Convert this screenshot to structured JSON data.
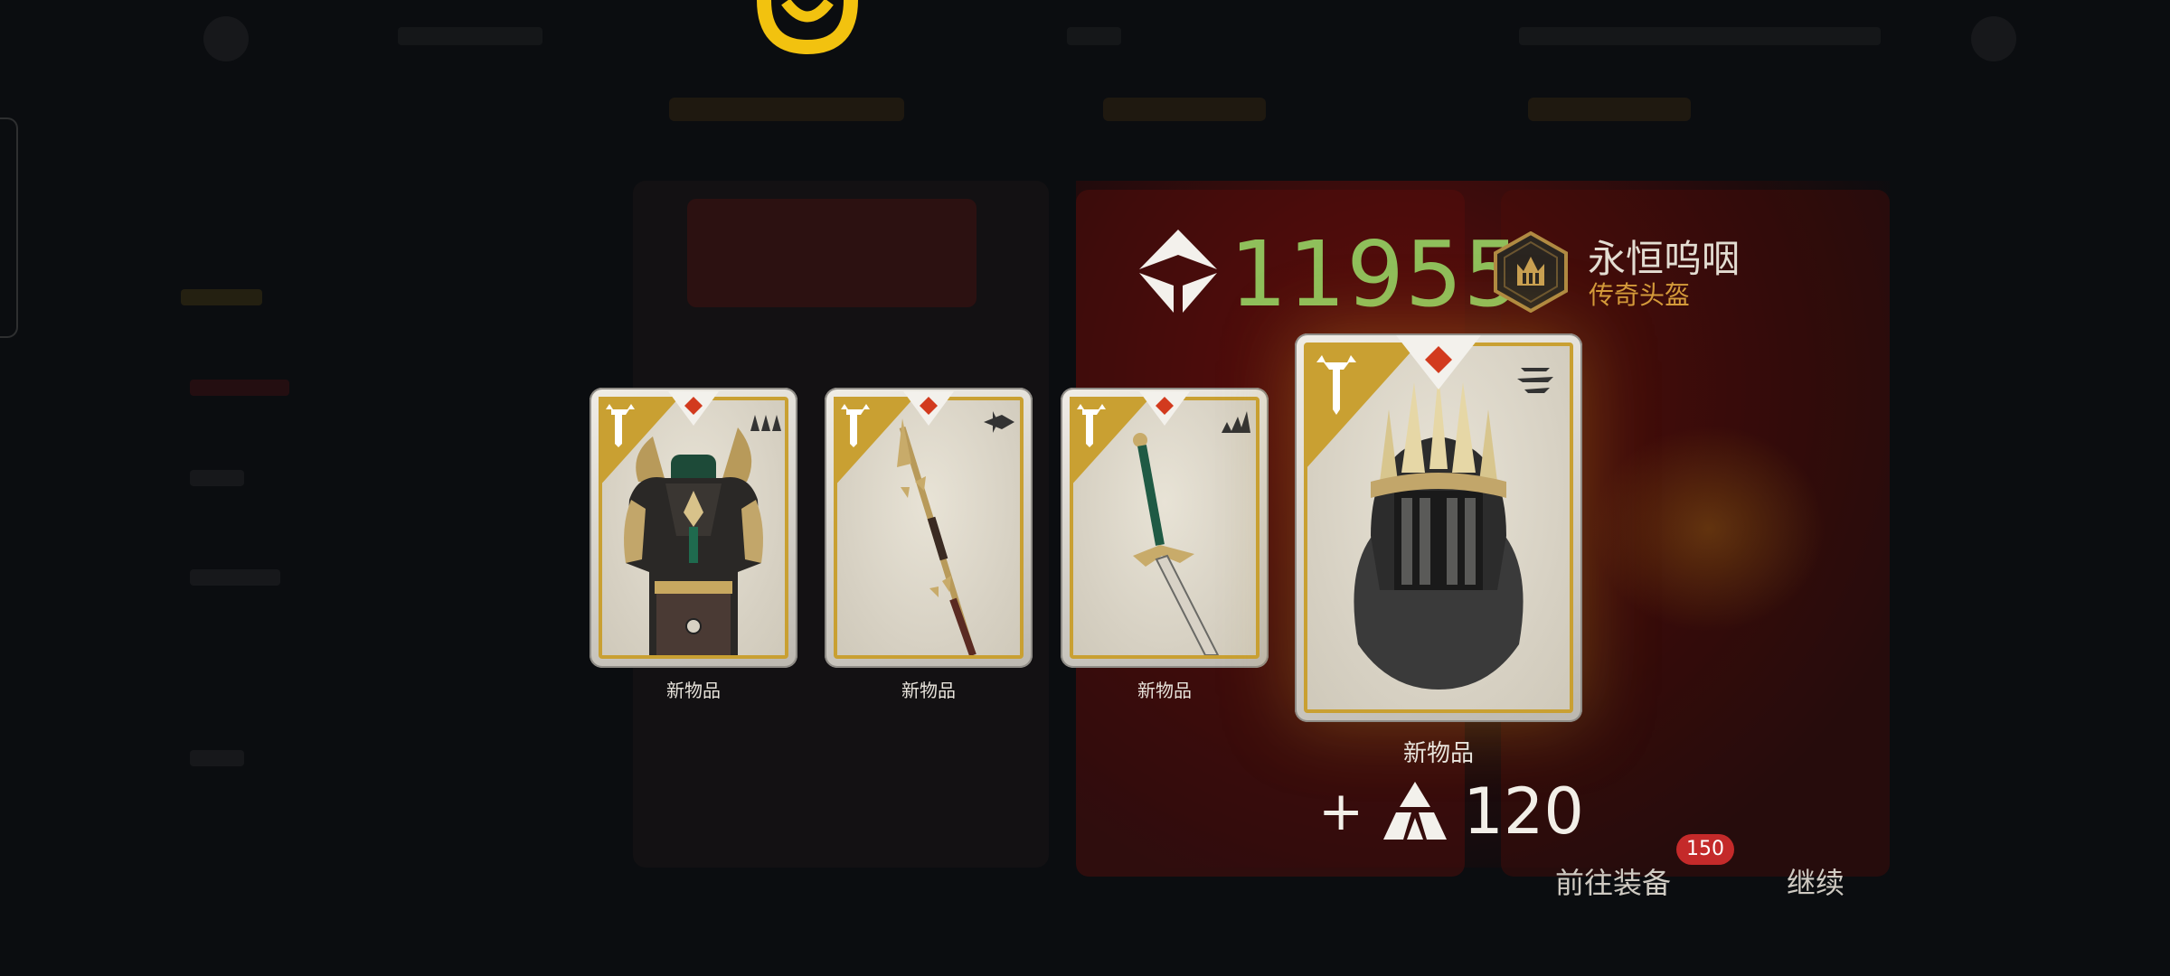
{
  "header": {
    "score_value": "11955",
    "item_name": "永恒呜咽",
    "item_type": "传奇头盔"
  },
  "cards": [
    {
      "caption": "新物品",
      "art": "armor-art",
      "type_icon": "weight-heavy-icon"
    },
    {
      "caption": "新物品",
      "art": "spear-art",
      "type_icon": "pierce-icon"
    },
    {
      "caption": "新物品",
      "art": "sword-art",
      "type_icon": "chop-icon"
    },
    {
      "caption": "新物品",
      "art": "helmet-art",
      "type_icon": "speed-lines-icon"
    }
  ],
  "reward": {
    "plus": "+",
    "value": "120"
  },
  "actions": {
    "equip_label": "前往装备",
    "equip_badge": "150",
    "continue_label": "继续"
  },
  "colors": {
    "score_green": "#8fbf5b",
    "legendary_gold": "#c9a032",
    "item_type_orange": "#d49a3a",
    "badge_red": "#c42a2a",
    "rarity_diamond": "#d23a1e"
  }
}
